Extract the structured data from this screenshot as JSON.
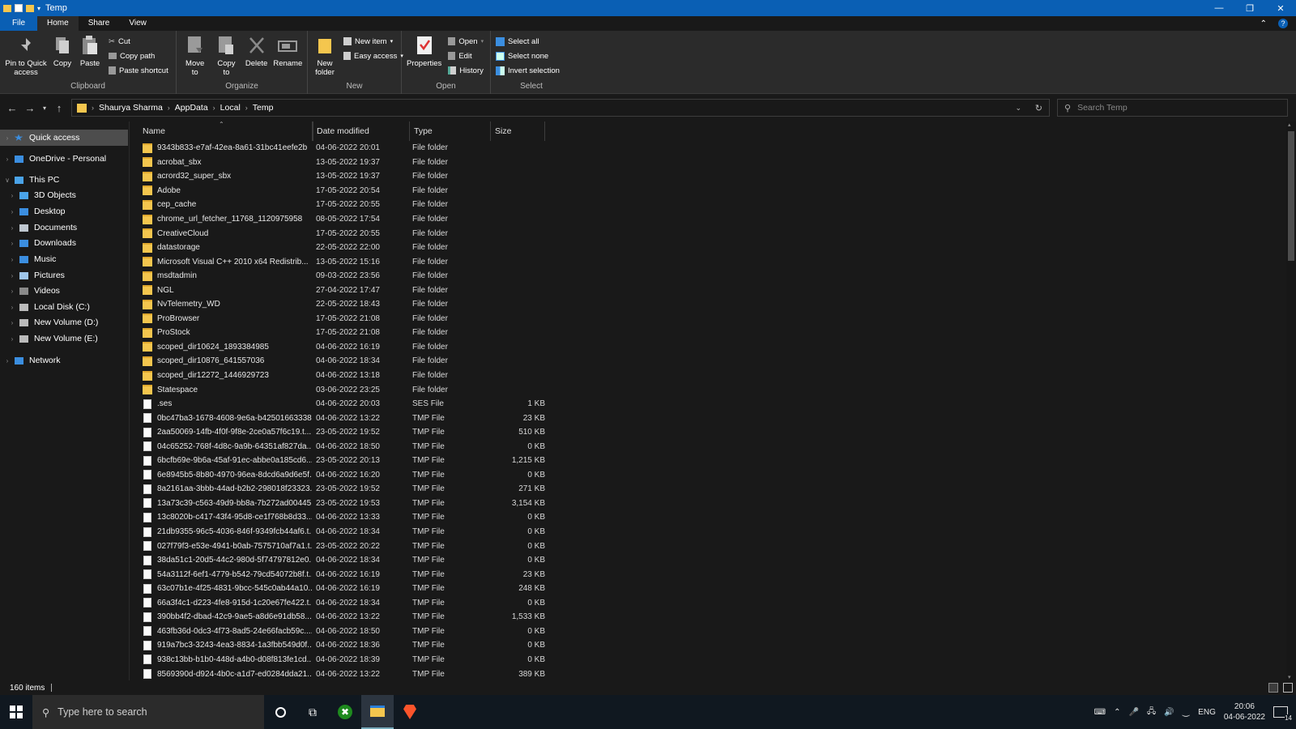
{
  "window": {
    "title": "Temp"
  },
  "menu": {
    "tabs": [
      "File",
      "Home",
      "Share",
      "View"
    ]
  },
  "ribbon": {
    "clipboard": {
      "group_label": "Clipboard",
      "pin": "Pin to Quick access",
      "copy": "Copy",
      "paste": "Paste",
      "cut": "Cut",
      "copy_path": "Copy path",
      "paste_shortcut": "Paste shortcut"
    },
    "organize": {
      "group_label": "Organize",
      "move_to": "Move to",
      "copy_to": "Copy to",
      "delete": "Delete",
      "rename": "Rename"
    },
    "new": {
      "group_label": "New",
      "new_folder": "New folder",
      "new_item": "New item",
      "easy_access": "Easy access"
    },
    "open": {
      "group_label": "Open",
      "properties": "Properties",
      "open": "Open",
      "edit": "Edit",
      "history": "History"
    },
    "select": {
      "group_label": "Select",
      "select_all": "Select all",
      "select_none": "Select none",
      "invert": "Invert selection"
    }
  },
  "address": {
    "crumbs": [
      "Shaurya Sharma",
      "AppData",
      "Local",
      "Temp"
    ]
  },
  "search": {
    "placeholder": "Search Temp"
  },
  "nav": [
    {
      "label": "Quick access",
      "indent": 0,
      "icon": "star-icon",
      "selected": true
    },
    {
      "label": "OneDrive - Personal",
      "indent": 0,
      "icon": "cloud-icon"
    },
    {
      "label": "This PC",
      "indent": 0,
      "icon": "pc-icon"
    },
    {
      "label": "3D Objects",
      "indent": 1,
      "icon": "cube-icon"
    },
    {
      "label": "Desktop",
      "indent": 1,
      "icon": "desktop-icon"
    },
    {
      "label": "Documents",
      "indent": 1,
      "icon": "document-icon"
    },
    {
      "label": "Downloads",
      "indent": 1,
      "icon": "download-icon"
    },
    {
      "label": "Music",
      "indent": 1,
      "icon": "music-icon"
    },
    {
      "label": "Pictures",
      "indent": 1,
      "icon": "picture-icon"
    },
    {
      "label": "Videos",
      "indent": 1,
      "icon": "video-icon"
    },
    {
      "label": "Local Disk (C:)",
      "indent": 1,
      "icon": "disk-icon"
    },
    {
      "label": "New Volume (D:)",
      "indent": 1,
      "icon": "disk-icon"
    },
    {
      "label": "New Volume (E:)",
      "indent": 1,
      "icon": "disk-icon"
    },
    {
      "label": "Network",
      "indent": 0,
      "icon": "network-icon"
    }
  ],
  "columns": [
    "Name",
    "Date modified",
    "Type",
    "Size"
  ],
  "files": [
    {
      "name": "9343b833-e7af-42ea-8a61-31bc41eefe2b",
      "date": "04-06-2022 20:01",
      "type": "File folder",
      "size": "",
      "kind": "folder"
    },
    {
      "name": "acrobat_sbx",
      "date": "13-05-2022 19:37",
      "type": "File folder",
      "size": "",
      "kind": "folder"
    },
    {
      "name": "acrord32_super_sbx",
      "date": "13-05-2022 19:37",
      "type": "File folder",
      "size": "",
      "kind": "folder"
    },
    {
      "name": "Adobe",
      "date": "17-05-2022 20:54",
      "type": "File folder",
      "size": "",
      "kind": "folder"
    },
    {
      "name": "cep_cache",
      "date": "17-05-2022 20:55",
      "type": "File folder",
      "size": "",
      "kind": "folder"
    },
    {
      "name": "chrome_url_fetcher_11768_1120975958",
      "date": "08-05-2022 17:54",
      "type": "File folder",
      "size": "",
      "kind": "folder"
    },
    {
      "name": "CreativeCloud",
      "date": "17-05-2022 20:55",
      "type": "File folder",
      "size": "",
      "kind": "folder"
    },
    {
      "name": "datastorage",
      "date": "22-05-2022 22:00",
      "type": "File folder",
      "size": "",
      "kind": "folder"
    },
    {
      "name": "Microsoft Visual C++ 2010  x64 Redistrib...",
      "date": "13-05-2022 15:16",
      "type": "File folder",
      "size": "",
      "kind": "folder"
    },
    {
      "name": "msdtadmin",
      "date": "09-03-2022 23:56",
      "type": "File folder",
      "size": "",
      "kind": "folder"
    },
    {
      "name": "NGL",
      "date": "27-04-2022 17:47",
      "type": "File folder",
      "size": "",
      "kind": "folder"
    },
    {
      "name": "NvTelemetry_WD",
      "date": "22-05-2022 18:43",
      "type": "File folder",
      "size": "",
      "kind": "folder"
    },
    {
      "name": "ProBrowser",
      "date": "17-05-2022 21:08",
      "type": "File folder",
      "size": "",
      "kind": "folder"
    },
    {
      "name": "ProStock",
      "date": "17-05-2022 21:08",
      "type": "File folder",
      "size": "",
      "kind": "folder"
    },
    {
      "name": "scoped_dir10624_1893384985",
      "date": "04-06-2022 16:19",
      "type": "File folder",
      "size": "",
      "kind": "folder"
    },
    {
      "name": "scoped_dir10876_641557036",
      "date": "04-06-2022 18:34",
      "type": "File folder",
      "size": "",
      "kind": "folder"
    },
    {
      "name": "scoped_dir12272_1446929723",
      "date": "04-06-2022 13:18",
      "type": "File folder",
      "size": "",
      "kind": "folder"
    },
    {
      "name": "Statespace",
      "date": "03-06-2022 23:25",
      "type": "File folder",
      "size": "",
      "kind": "folder"
    },
    {
      "name": ".ses",
      "date": "04-06-2022 20:03",
      "type": "SES File",
      "size": "1 KB",
      "kind": "file"
    },
    {
      "name": "0bc47ba3-1678-4608-9e6a-b42501663338...",
      "date": "04-06-2022 13:22",
      "type": "TMP File",
      "size": "23 KB",
      "kind": "file"
    },
    {
      "name": "2aa50069-14fb-4f0f-9f8e-2ce0a57f6c19.t...",
      "date": "23-05-2022 19:52",
      "type": "TMP File",
      "size": "510 KB",
      "kind": "file"
    },
    {
      "name": "04c65252-768f-4d8c-9a9b-64351af827da....",
      "date": "04-06-2022 18:50",
      "type": "TMP File",
      "size": "0 KB",
      "kind": "file"
    },
    {
      "name": "6bcfb69e-9b6a-45af-91ec-abbe0a185cd6....",
      "date": "23-05-2022 20:13",
      "type": "TMP File",
      "size": "1,215 KB",
      "kind": "file"
    },
    {
      "name": "6e8945b5-8b80-4970-96ea-8dcd6a9d6e5f...",
      "date": "04-06-2022 16:20",
      "type": "TMP File",
      "size": "0 KB",
      "kind": "file"
    },
    {
      "name": "8a2161aa-3bbb-44ad-b2b2-298018f23323....",
      "date": "23-05-2022 19:52",
      "type": "TMP File",
      "size": "271 KB",
      "kind": "file"
    },
    {
      "name": "13a73c39-c563-49d9-bb8a-7b272ad00445....",
      "date": "23-05-2022 19:53",
      "type": "TMP File",
      "size": "3,154 KB",
      "kind": "file"
    },
    {
      "name": "13c8020b-c417-43f4-95d8-ce1f768b8d33....",
      "date": "04-06-2022 13:33",
      "type": "TMP File",
      "size": "0 KB",
      "kind": "file"
    },
    {
      "name": "21db9355-96c5-4036-846f-9349fcb44af6.t...",
      "date": "04-06-2022 18:34",
      "type": "TMP File",
      "size": "0 KB",
      "kind": "file"
    },
    {
      "name": "027f79f3-e53e-4941-b0ab-7575710af7a1.t...",
      "date": "23-05-2022 20:22",
      "type": "TMP File",
      "size": "0 KB",
      "kind": "file"
    },
    {
      "name": "38da51c1-20d5-44c2-980d-5f74797812e0....",
      "date": "04-06-2022 18:34",
      "type": "TMP File",
      "size": "0 KB",
      "kind": "file"
    },
    {
      "name": "54a3112f-6ef1-4779-b542-79cd54072b8f.t...",
      "date": "04-06-2022 16:19",
      "type": "TMP File",
      "size": "23 KB",
      "kind": "file"
    },
    {
      "name": "63c07b1e-4f25-4831-9bcc-545c0ab44a10....",
      "date": "04-06-2022 16:19",
      "type": "TMP File",
      "size": "248 KB",
      "kind": "file"
    },
    {
      "name": "66a3f4c1-d223-4fe8-915d-1c20e67fe422.t...",
      "date": "04-06-2022 18:34",
      "type": "TMP File",
      "size": "0 KB",
      "kind": "file"
    },
    {
      "name": "390bb4f2-dbad-42c9-9ae5-a8d6e91db58....",
      "date": "04-06-2022 13:22",
      "type": "TMP File",
      "size": "1,533 KB",
      "kind": "file"
    },
    {
      "name": "463fb36d-0dc3-4f73-8ad5-24e66facb59c....",
      "date": "04-06-2022 18:50",
      "type": "TMP File",
      "size": "0 KB",
      "kind": "file"
    },
    {
      "name": "919a7bc3-3243-4ea3-8834-1a3fbb549d0f....",
      "date": "04-06-2022 18:36",
      "type": "TMP File",
      "size": "0 KB",
      "kind": "file"
    },
    {
      "name": "938c13bb-b1b0-448d-a4b0-d08f813fe1cd....",
      "date": "04-06-2022 18:39",
      "type": "TMP File",
      "size": "0 KB",
      "kind": "file"
    },
    {
      "name": "8569390d-d924-4b0c-a1d7-ed0284dda21...",
      "date": "04-06-2022 13:22",
      "type": "TMP File",
      "size": "389 KB",
      "kind": "file"
    }
  ],
  "status": {
    "count": "160 items"
  },
  "taskbar": {
    "search_placeholder": "Type here to search",
    "lang": "ENG",
    "time": "20:06",
    "date": "04-06-2022",
    "notif": "14"
  },
  "colors": {
    "titlebar": "#0a5fb4",
    "accent_file_tab": "#0a5fb4",
    "folder": "#f4c64e",
    "background": "#191919",
    "ribbon": "#2b2b2b"
  }
}
